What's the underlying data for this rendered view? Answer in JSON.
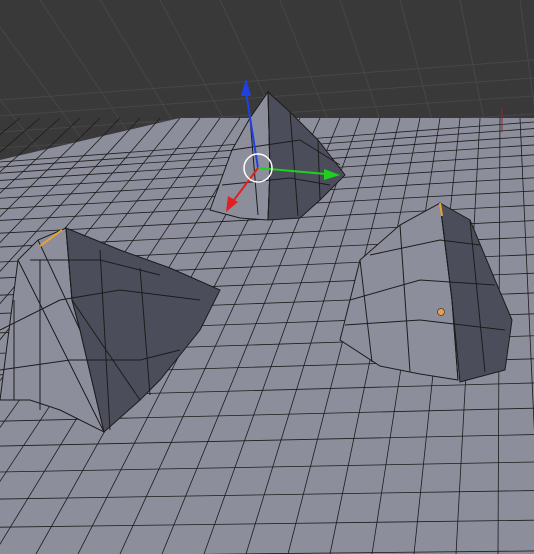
{
  "viewport": {
    "name": "3D Viewport",
    "background_color": "#393939",
    "grid_line_color": "#474747",
    "mesh": {
      "name": "terrain-plane",
      "face_color": "#8d8e9c",
      "face_shadow_color": "#4c4d5a",
      "wire_color": "#1c1c1c",
      "selected_edge_color": "#f0a030",
      "peaks": [
        "left-mound",
        "center-peak",
        "right-ridge"
      ]
    },
    "gizmo": {
      "x_axis_color": "#e02020",
      "y_axis_color": "#20d020",
      "z_axis_color": "#2040e0",
      "cursor_color": "#ffffff"
    },
    "selected_vertex_color": "#e0a060"
  }
}
